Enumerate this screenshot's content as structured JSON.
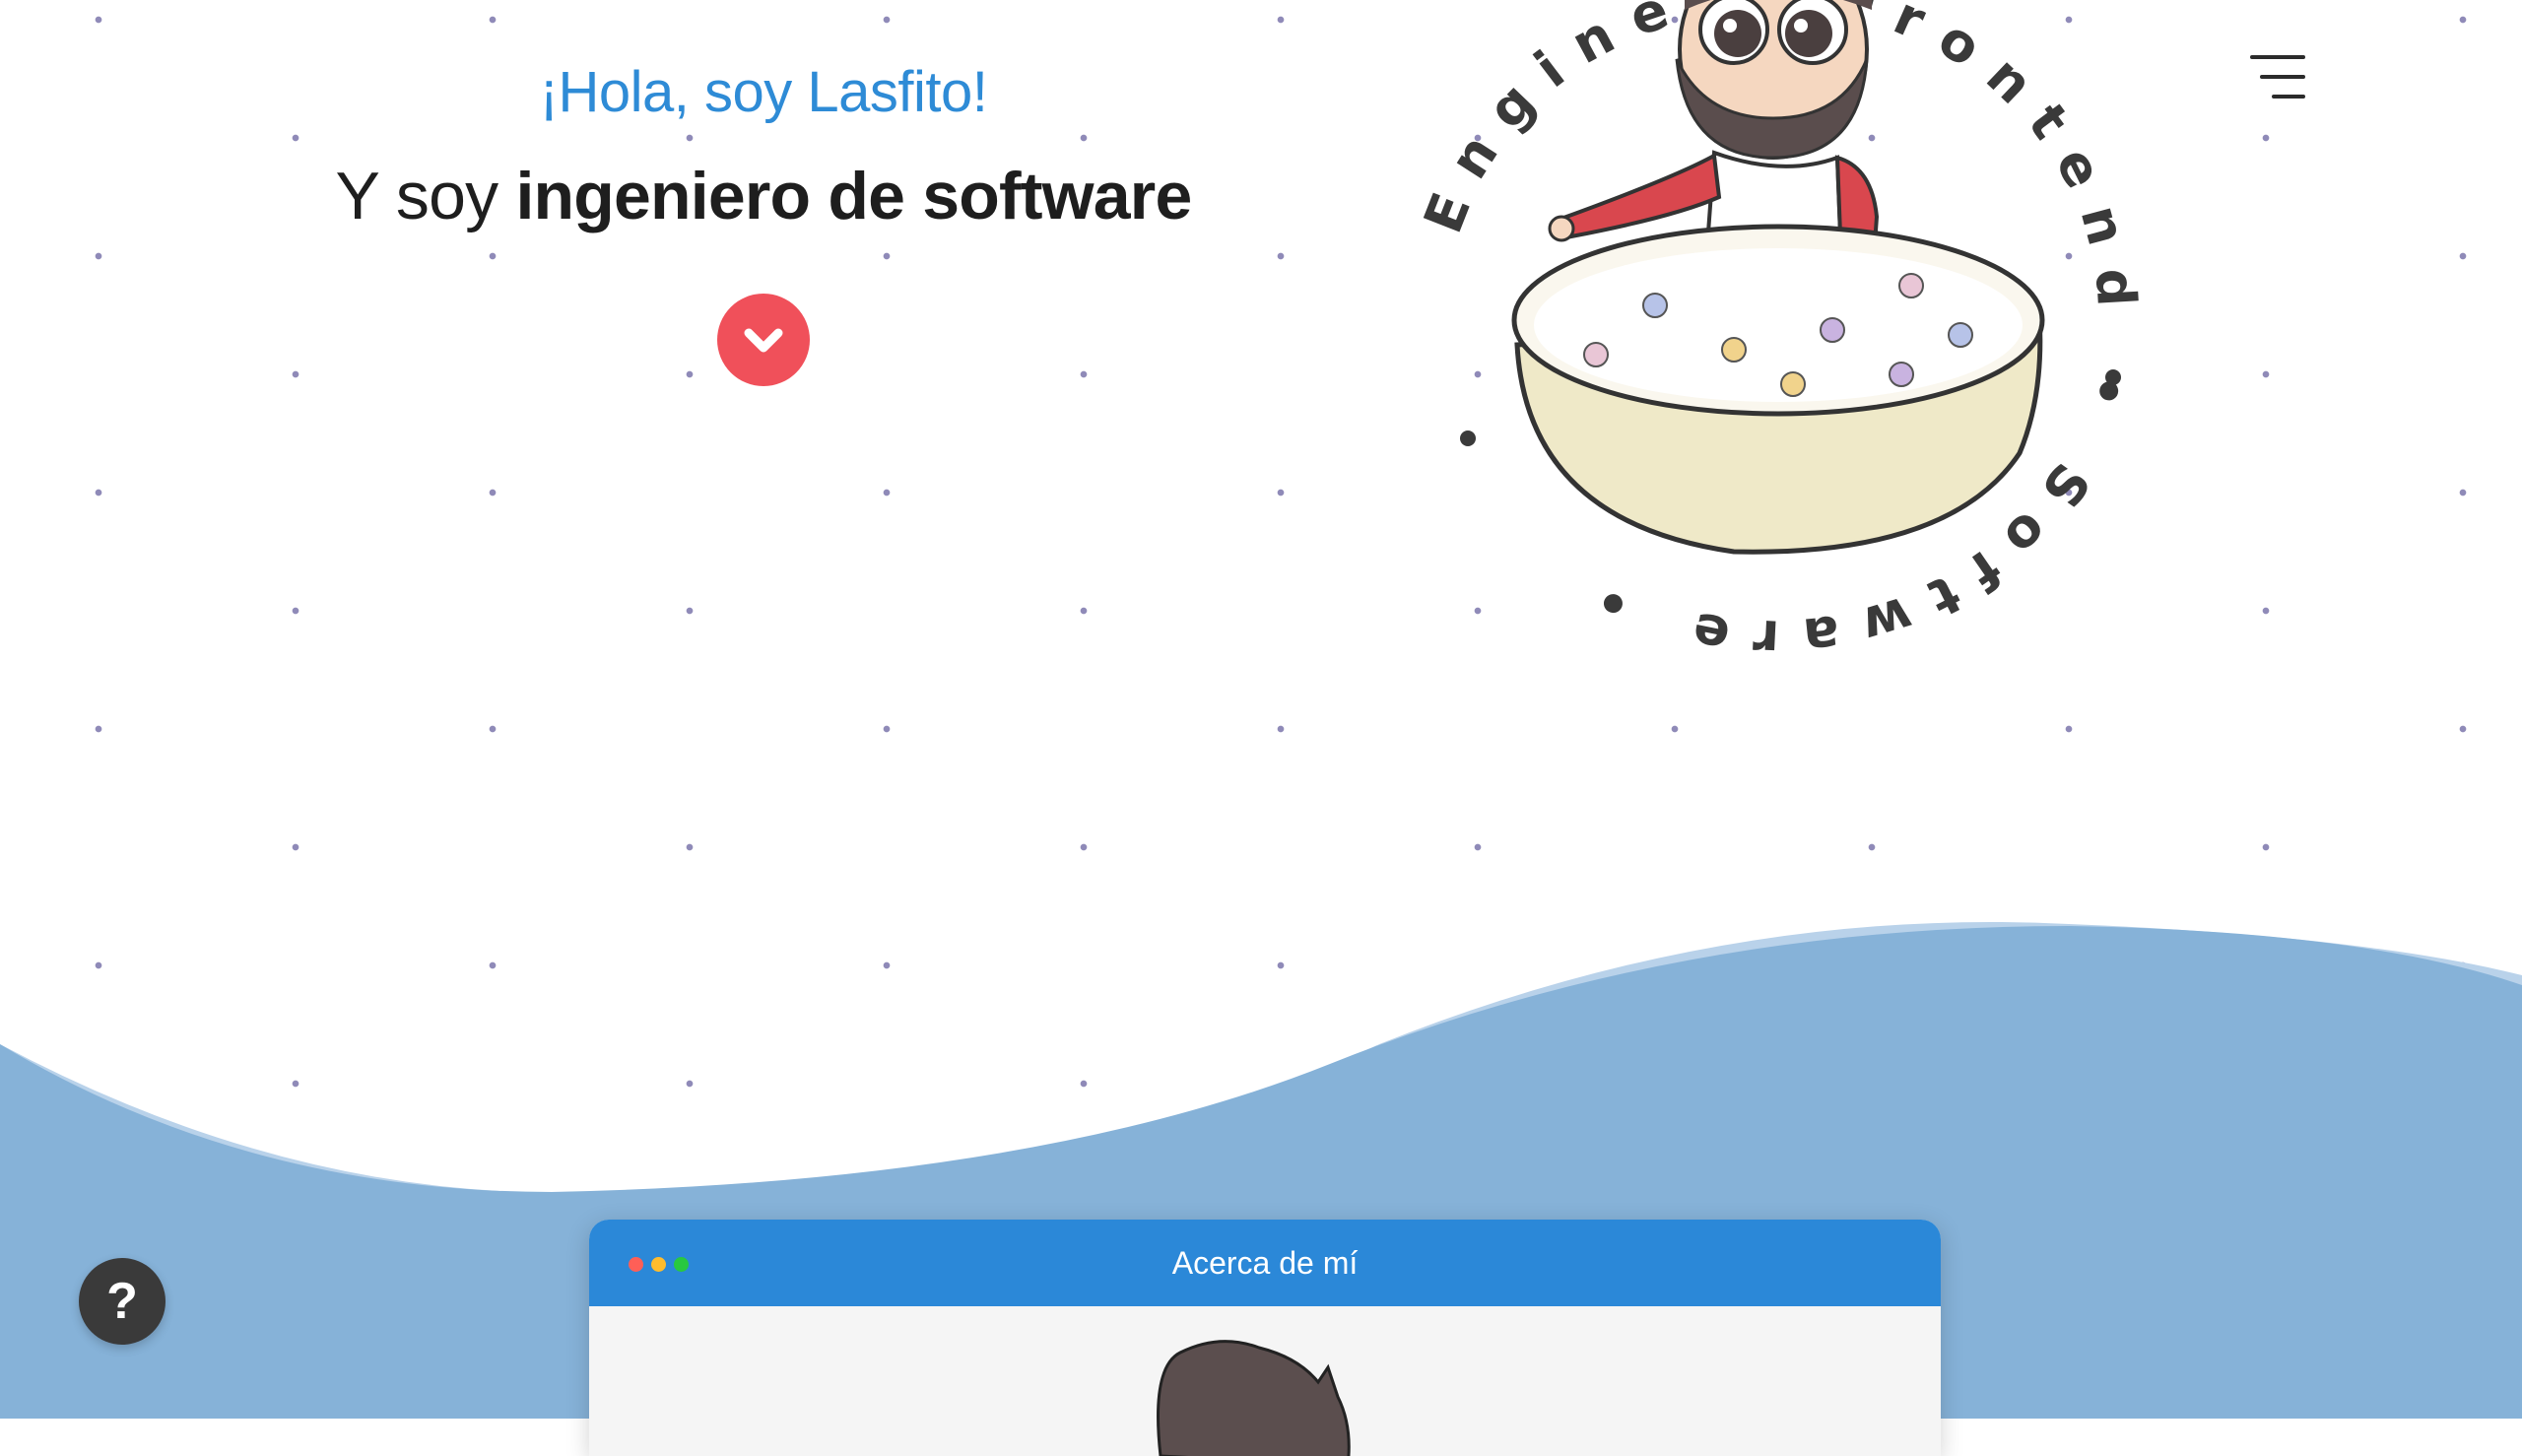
{
  "hero": {
    "greeting": "¡Hola, soy Lasfito!",
    "tagline_prefix": "Y soy ",
    "tagline_bold": "ingeniero de software"
  },
  "badge": {
    "circular_text": "Engineer Frontend • Software •",
    "illustration": "bearded man sitting in a cereal bowl"
  },
  "window": {
    "title": "Acerca de mí"
  },
  "help_button": {
    "label": "?"
  },
  "colors": {
    "accent": "#2e8bd6",
    "scroll_button": "#f0505a",
    "wave": "#86b2d8",
    "window_titlebar": "#2b88d8",
    "help_button": "#3a3a3a",
    "dots": "#8f8ab8"
  },
  "icons": {
    "scroll": "chevron-down-icon",
    "menu": "hamburger-menu-icon",
    "help": "question-mark-icon"
  }
}
